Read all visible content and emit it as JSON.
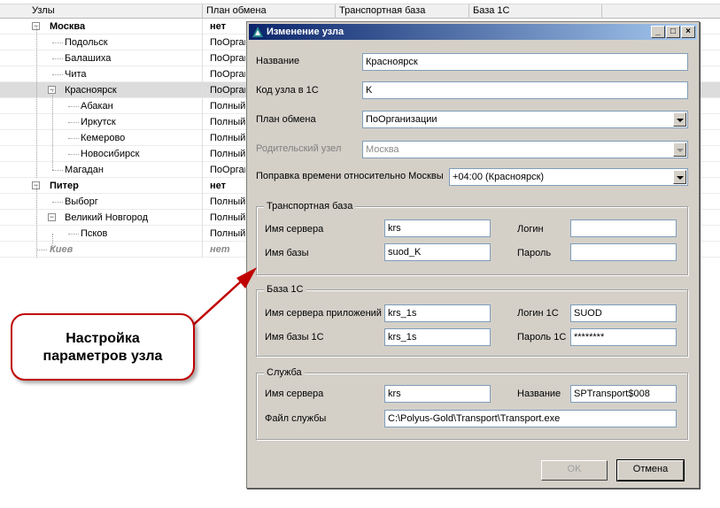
{
  "grid": {
    "columns": [
      "Узлы",
      "План обмена",
      "Транспортная база",
      "База 1С"
    ],
    "rows": [
      {
        "label": "Москва",
        "plan": "нет",
        "level": 0,
        "bold": true,
        "expander": "−"
      },
      {
        "label": "Подольск",
        "plan": "ПоОргани",
        "level": 1
      },
      {
        "label": "Балашиха",
        "plan": "ПоОргани",
        "level": 1
      },
      {
        "label": "Чита",
        "plan": "ПоОргани",
        "level": 1
      },
      {
        "label": "Красноярск",
        "plan": "ПоОргани",
        "level": 1,
        "selected": true,
        "expander": "−"
      },
      {
        "label": "Абакан",
        "plan": "Полный",
        "level": 2
      },
      {
        "label": "Иркутск",
        "plan": "Полный",
        "level": 2
      },
      {
        "label": "Кемерово",
        "plan": "Полный",
        "level": 2
      },
      {
        "label": "Новосибирск",
        "plan": "Полный",
        "level": 2
      },
      {
        "label": "Магадан",
        "plan": "ПоОргани",
        "level": 1
      },
      {
        "label": "Питер",
        "plan": "нет",
        "level": 0,
        "bold": true,
        "expander": "−"
      },
      {
        "label": "Выборг",
        "plan": "Полный",
        "level": 1
      },
      {
        "label": "Великий Новгород",
        "plan": "Полный",
        "level": 1,
        "expander": "−"
      },
      {
        "label": "Псков",
        "plan": "Полный",
        "level": 2
      },
      {
        "label": "Киев",
        "plan": "нет",
        "level": 0,
        "muted": true
      }
    ]
  },
  "dialog": {
    "title": "Изменение узла",
    "title_buttons": [
      "_",
      "□",
      "×"
    ],
    "name_label": "Название",
    "name_value": "Красноярск",
    "code_label": "Код узла в 1С",
    "code_value": "K",
    "plan_label": "План обмена",
    "plan_value": "ПоОрганизации",
    "parent_label": "Родительский узел",
    "parent_value": "Москва",
    "tz_label": "Поправка времени относительно Москвы",
    "tz_value": "+04:00 (Красноярск)",
    "transport": {
      "title": "Транспортная база",
      "server_label": "Имя сервера",
      "server_value": "krs",
      "db_label": "Имя базы",
      "db_value": "suod_K",
      "login_label": "Логин",
      "login_value": "",
      "password_label": "Пароль",
      "password_value": ""
    },
    "base1c": {
      "title": "База 1С",
      "app_server_label": "Имя сервера приложений",
      "app_server_value": "krs_1s",
      "db_label": "Имя базы 1С",
      "db_value": "krs_1s",
      "login_label": "Логин 1С",
      "login_value": "SUOD",
      "password_label": "Пароль 1С",
      "password_value": "********"
    },
    "service": {
      "title": "Служба",
      "server_label": "Имя сервера",
      "server_value": "krs",
      "name_label": "Название",
      "name_value": "SPTransport$008",
      "file_label": "Файл службы",
      "file_value": "C:\\Polyus-Gold\\Transport\\Transport.exe"
    },
    "ok_label": "OK",
    "cancel_label": "Отмена"
  },
  "callout": {
    "line1": "Настройка",
    "line2": "параметров узла"
  },
  "colors": {
    "accent": "#0a246a",
    "callout_border": "#c00000"
  }
}
